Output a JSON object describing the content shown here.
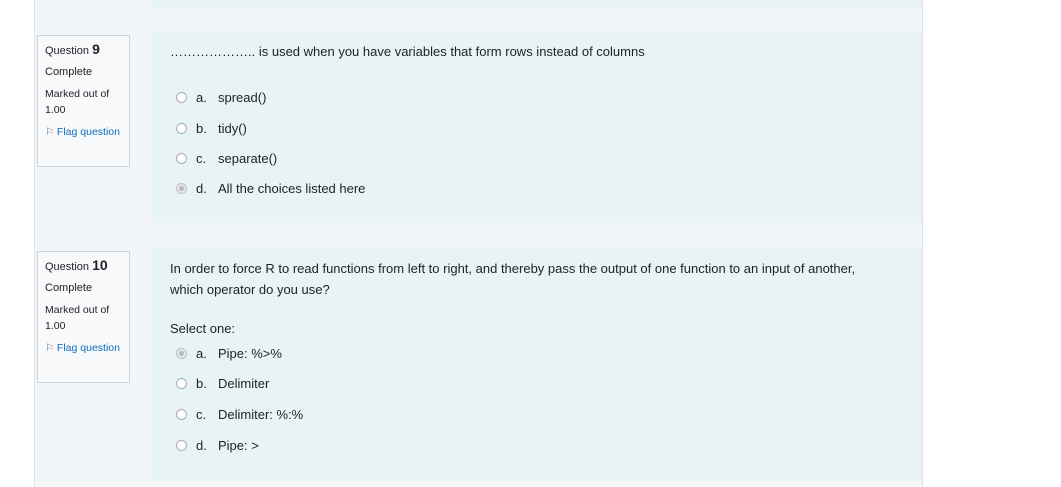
{
  "questions": [
    {
      "number_prefix": "Question",
      "number": "9",
      "state": "Complete",
      "grade": "Marked out of 1.00",
      "flag_label": "Flag question",
      "text": "……………….. is used when you have variables that form rows instead of columns",
      "prompt": "",
      "answers": [
        {
          "letter": "a.",
          "text": "spread()",
          "checked": false
        },
        {
          "letter": "b.",
          "text": "tidy()",
          "checked": false
        },
        {
          "letter": "c.",
          "text": "separate()",
          "checked": false
        },
        {
          "letter": "d.",
          "text": "All the choices listed here",
          "checked": true
        }
      ]
    },
    {
      "number_prefix": "Question",
      "number": "10",
      "state": "Complete",
      "grade": "Marked out of 1.00",
      "flag_label": "Flag question",
      "text": "In order to force R to read functions from left to right, and thereby pass the output of one function to an input of another, which operator do you use?",
      "prompt": "Select one:",
      "answers": [
        {
          "letter": "a.",
          "text": "Pipe: %>%",
          "checked": true
        },
        {
          "letter": "b.",
          "text": "Delimiter",
          "checked": false
        },
        {
          "letter": "c.",
          "text": "Delimiter: %:%",
          "checked": false
        },
        {
          "letter": "d.",
          "text": "Pipe: >",
          "checked": false
        }
      ]
    }
  ]
}
